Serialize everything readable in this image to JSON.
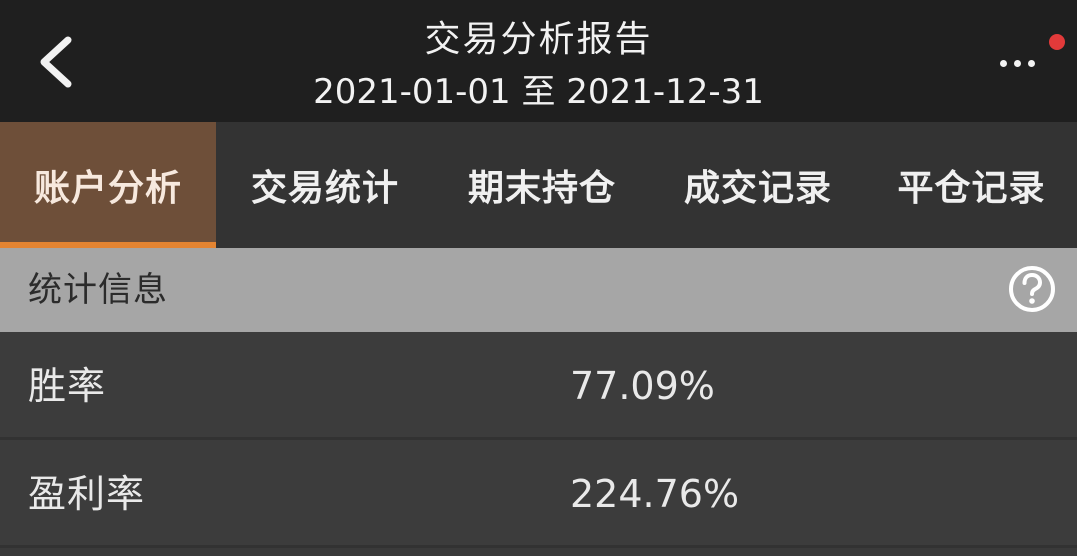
{
  "header": {
    "title": "交易分析报告",
    "date_range": "2021-01-01 至 2021-12-31",
    "back_icon": "chevron-left-icon",
    "more_icon": "more-horizontal-icon",
    "badge_color": "#e23a3a"
  },
  "tabs": [
    {
      "label": "账户分析",
      "active": true
    },
    {
      "label": "交易统计",
      "active": false
    },
    {
      "label": "期末持仓",
      "active": false
    },
    {
      "label": "成交记录",
      "active": false
    },
    {
      "label": "平仓记录",
      "active": false
    }
  ],
  "section": {
    "title": "统计信息",
    "help_icon": "question-circle-icon"
  },
  "stats": [
    {
      "label": "胜率",
      "value": "77.09%"
    },
    {
      "label": "盈利率",
      "value": "224.76%"
    }
  ],
  "colors": {
    "header_bg": "#1f1f1f",
    "tab_bg": "#333333",
    "active_tab_bg": "#6e4f39",
    "active_tab_indicator": "#e38432",
    "section_bg": "#a6a6a6",
    "row_bg": "#3c3c3c"
  }
}
